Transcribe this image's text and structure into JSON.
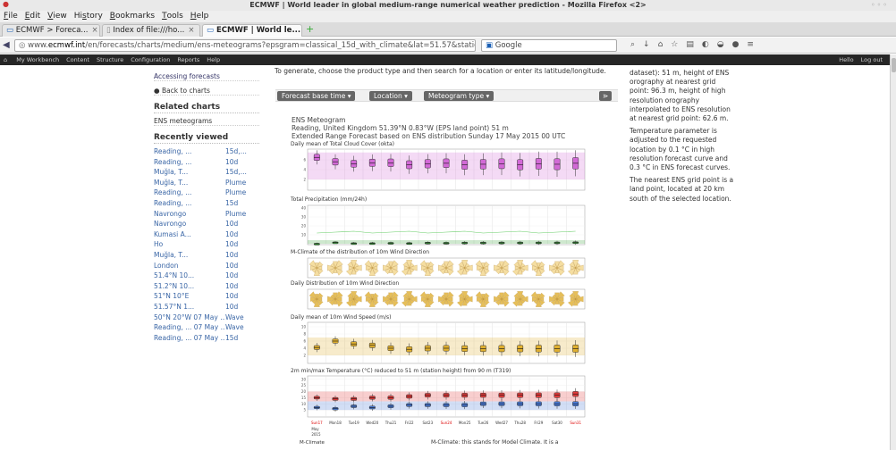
{
  "window": {
    "title": "ECMWF | World leader in global medium-range numerical weather prediction - Mozilla Firefox <2>"
  },
  "menu": [
    {
      "pre": "",
      "u": "F",
      "post": "ile"
    },
    {
      "pre": "",
      "u": "E",
      "post": "dit"
    },
    {
      "pre": "",
      "u": "V",
      "post": "iew"
    },
    {
      "pre": "Hi",
      "u": "s",
      "post": "tory"
    },
    {
      "pre": "",
      "u": "B",
      "post": "ookmarks"
    },
    {
      "pre": "",
      "u": "T",
      "post": "ools"
    },
    {
      "pre": "",
      "u": "H",
      "post": "elp"
    }
  ],
  "tabs": [
    {
      "label": "ECMWF > Foreca..."
    },
    {
      "label": "Index of file:///ho..."
    },
    {
      "label": "ECMWF | World le..."
    }
  ],
  "url": {
    "prefix": "www.",
    "domain": "ecmwf.int",
    "rest": "/en/forecasts/charts/medium/ens-meteograms?epsgram=classical_15d_with_climate&lat=51.57&station_n"
  },
  "search": {
    "engine": "Google"
  },
  "adminbar": {
    "items": [
      "My Workbench",
      "Content",
      "Structure",
      "Configuration",
      "Reports",
      "Help"
    ],
    "greeting": "Hello",
    "logout": "Log out"
  },
  "sidebar": {
    "accessing": "Accessing forecasts",
    "back": "Back to charts",
    "related_head": "Related charts",
    "related_link": "ENS meteograms",
    "recent_head": "Recently viewed",
    "recent": [
      {
        "place": "Reading, ...",
        "type": "15d,..."
      },
      {
        "place": "Reading, ...",
        "type": "10d"
      },
      {
        "place": "Muğla, T...",
        "type": "15d,..."
      },
      {
        "place": "Muğla, T...",
        "type": "Plume"
      },
      {
        "place": "Reading, ...",
        "type": "Plume"
      },
      {
        "place": "Reading, ...",
        "type": "15d"
      },
      {
        "place": "Navrongo",
        "type": "Plume"
      },
      {
        "place": "Navrongo",
        "type": "10d"
      },
      {
        "place": "Kumasi A...",
        "type": "10d"
      },
      {
        "place": "Ho",
        "type": "10d"
      },
      {
        "place": "Muğla, T...",
        "type": "10d"
      },
      {
        "place": "London",
        "type": "10d"
      },
      {
        "place": "51.4°N 10...",
        "type": "10d"
      },
      {
        "place": "51.2°N 10...",
        "type": "10d"
      },
      {
        "place": "51°N 10°E",
        "type": "10d"
      },
      {
        "place": "51.57°N 1...",
        "type": "10d"
      },
      {
        "place": "50°N 20°W  07 May ...",
        "type": "Wave"
      },
      {
        "place": "Reading, ...  07 May ...",
        "type": "Wave"
      },
      {
        "place": "Reading, ...  07 May ...",
        "type": "15d"
      }
    ]
  },
  "main": {
    "intro": "To generate, choose the product type and then search for a location or enter its latitude/longitude.",
    "buttons": [
      "Forecast base time",
      "Location",
      "Meteogram type"
    ],
    "meteogram": {
      "title": "ENS Meteogram",
      "location": "Reading, United Kingdom 51.39°N 0.83°W (EPS land point) 51 m",
      "extended": "Extended Range Forecast based on ENS distribution Sunday 17 May 2015 00 UTC"
    },
    "panels": [
      "Daily mean of Total Cloud Cover (okta)",
      "Total Precipitation (mm/24h)",
      "M-Climate of the distribution of 10m Wind Direction",
      "Daily Distribution of 10m Wind Direction",
      "Daily mean of 10m Wind Speed (m/s)",
      "2m min/max Temperature (°C) reduced to 51 m (station height) from 90 m (T319)"
    ],
    "dates": [
      "Sun17",
      "Mon18",
      "Tue19",
      "Wed20",
      "Thu21",
      "Fri22",
      "Sat23",
      "Sun24",
      "Mon25",
      "Tue26",
      "Wed27",
      "Thu28",
      "Fri29",
      "Sat30",
      "Sun31"
    ],
    "date_month": "May",
    "date_year": "2015",
    "footer_legend": "M-Climate",
    "footer_text": "M-Climate: this stands for Model Climate. It is a"
  },
  "rightcol": {
    "p1": "dataset): 51 m, height of ENS orography at nearest grid point: 96.3 m, height of high resolution orography interpolated to ENS resolution at nearest grid point: 62.6 m.",
    "p2": "Temperature parameter is adjusted to the requested location by 0.1 °C in high resolution forecast curve and 0.3 °C in ENS forecast curves.",
    "p3": "The nearest ENS grid point is a land point, located at 20 km south of the selected location."
  },
  "colors": {
    "cloud": "#d26ad6",
    "precip": "#3aa33a",
    "wind": "#e0b030",
    "temp_max": "#e23b3b",
    "temp_min": "#4a7bd8",
    "link": "#3a66a6"
  },
  "chart_data": [
    {
      "type": "box",
      "title": "Daily mean of Total Cloud Cover (okta)",
      "ylim": [
        0,
        8
      ],
      "x": [
        "Sun17",
        "Mon18",
        "Tue19",
        "Wed20",
        "Thu21",
        "Fri22",
        "Sat23",
        "Sun24",
        "Mon25",
        "Tue26",
        "Wed27",
        "Thu28",
        "Fri29",
        "Sat30",
        "Sun31"
      ],
      "median": [
        6.5,
        5.6,
        5.2,
        5.4,
        5.4,
        5.0,
        5.2,
        5.3,
        5.0,
        5.1,
        5.2,
        5.0,
        5.2,
        5.1,
        5.3
      ]
    },
    {
      "type": "box",
      "title": "Total Precipitation (mm/24h)",
      "ylim": [
        0,
        40
      ],
      "x": [
        "Sun17",
        "Mon18",
        "Tue19",
        "Wed20",
        "Thu21",
        "Fri22",
        "Sat23",
        "Sun24",
        "Mon25",
        "Tue26",
        "Wed27",
        "Thu28",
        "Fri29",
        "Sat30",
        "Sun31"
      ],
      "median": [
        0,
        1.5,
        0.5,
        0.5,
        0.8,
        0.5,
        1.0,
        0.8,
        1.0,
        1.0,
        1.0,
        1.0,
        1.0,
        1.0,
        1.2
      ]
    },
    {
      "type": "box",
      "title": "Daily mean of 10m Wind Speed (m/s)",
      "ylim": [
        0,
        10
      ],
      "x": [
        "Sun17",
        "Mon18",
        "Tue19",
        "Wed20",
        "Thu21",
        "Fri22",
        "Sat23",
        "Sun24",
        "Mon25",
        "Tue26",
        "Wed27",
        "Thu28",
        "Fri29",
        "Sat30",
        "Sun31"
      ],
      "median": [
        4.2,
        6.0,
        5.2,
        4.8,
        4.0,
        3.7,
        4.0,
        4.0,
        3.9,
        3.9,
        3.9,
        3.9,
        3.9,
        3.9,
        3.9
      ]
    },
    {
      "type": "box",
      "title": "2m min/max Temperature (°C) reduced to 51 m (station height) from 90 m (T319)",
      "ylim": [
        0,
        30
      ],
      "x": [
        "Sun17",
        "Mon18",
        "Tue19",
        "Wed20",
        "Thu21",
        "Fri22",
        "Sat23",
        "Sun24",
        "Mon25",
        "Tue26",
        "Wed27",
        "Thu28",
        "Fri29",
        "Sat30",
        "Sun31"
      ],
      "max": [
        15,
        14,
        14,
        15,
        15,
        16,
        17,
        17,
        17,
        17,
        17,
        17,
        17,
        17,
        18
      ],
      "min": [
        7,
        6,
        8,
        7,
        8,
        9,
        9,
        9,
        9,
        10,
        10,
        10,
        10,
        10,
        10
      ]
    }
  ]
}
